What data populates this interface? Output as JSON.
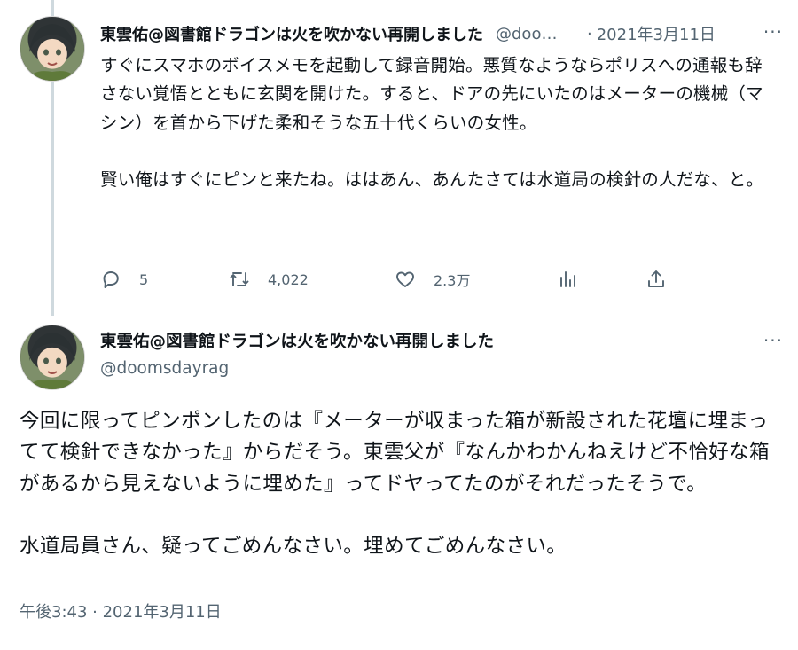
{
  "tweet1": {
    "author_name": "東雲佑@図書館ドラゴンは火を吹かない再開しました",
    "handle": "@doomsdayrag",
    "separator": "·",
    "date": "2021年3月11日",
    "more": "···",
    "paragraphs": [
      "すぐにスマホのボイスメモを起動して録音開始。悪質なようならポリスへの通報も辞さない覚悟とともに玄関を開けた。すると、ドアの先にいたのはメーターの機械（マシン）を首から下げた柔和そうな五十代くらいの女性。",
      "賢い俺はすぐにピンと来たね。ははあん、あんたさては水道局の検針の人だな、と。"
    ],
    "actions": {
      "reply_count": "5",
      "retweet_count": "4,022",
      "like_count": "2.3万"
    }
  },
  "tweet2": {
    "author_name": "東雲佑@図書館ドラゴンは火を吹かない再開しました",
    "handle": "@doomsdayrag",
    "more": "···",
    "paragraphs": [
      "今回に限ってピンポンしたのは『メーターが収まった箱が新設された花壇に埋まってて検針できなかった』からだそう。東雲父が『なんかわかんねえけど不恰好な箱があるから見えないように埋めた』ってドヤってたのがそれだったそうで。",
      "水道局員さん、疑ってごめんなさい。埋めてごめんなさい。"
    ],
    "timestamp": "午後3:43 · 2021年3月11日"
  },
  "icons": {
    "avatar": "avatar-image",
    "reply": "reply-icon",
    "retweet": "retweet-icon",
    "like": "like-icon",
    "views": "views-icon",
    "share": "share-icon",
    "more": "more-icon"
  },
  "colors": {
    "text": "#0f1419",
    "secondary": "#536471",
    "thread_line": "#cfd9de",
    "background": "#ffffff"
  }
}
